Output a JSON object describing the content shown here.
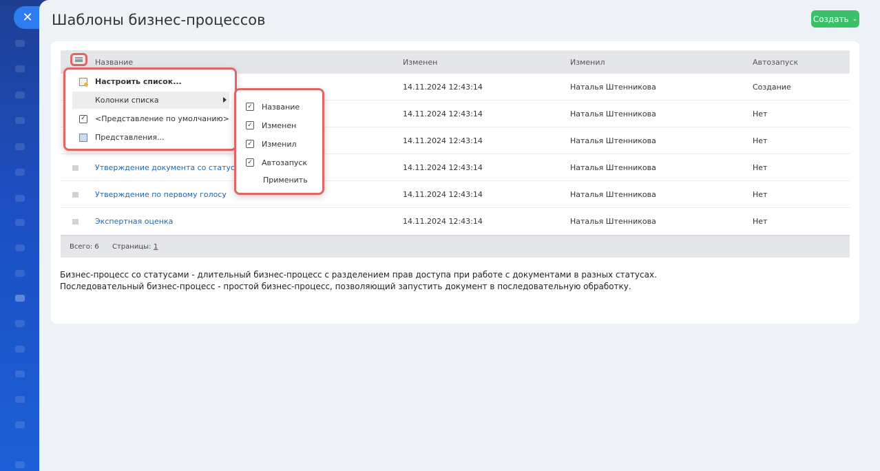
{
  "page": {
    "title": "Шаблоны бизнес-процессов",
    "create_label": "Создать",
    "close_icon": "close-icon"
  },
  "table": {
    "columns": [
      "Название",
      "Изменен",
      "Изменил",
      "Автозапуск"
    ],
    "rows": [
      {
        "name": "",
        "modified": "14.11.2024 12:43:14",
        "author": "Наталья Штенникова",
        "autorun": "Создание"
      },
      {
        "name": "",
        "modified": "14.11.2024 12:43:14",
        "author": "Наталья Штенникова",
        "autorun": "Нет"
      },
      {
        "name": "",
        "modified": "14.11.2024 12:43:14",
        "author": "Наталья Штенникова",
        "autorun": "Нет"
      },
      {
        "name": "Утверждение документа со статусами",
        "modified": "14.11.2024 12:43:14",
        "author": "Наталья Штенникова",
        "autorun": "Нет"
      },
      {
        "name": "Утверждение по первому голосу",
        "modified": "14.11.2024 12:43:14",
        "author": "Наталья Штенникова",
        "autorun": "Нет"
      },
      {
        "name": "Экспертная оценка",
        "modified": "14.11.2024 12:43:14",
        "author": "Наталья Штенникова",
        "autorun": "Нет"
      }
    ]
  },
  "footer": {
    "total": "Всего: 6",
    "pages_label": "Страницы:",
    "page_number": "1"
  },
  "description": {
    "line1": "Бизнес-процесс со статусами - длительный бизнес-процесс с разделением прав доступа при работе с документами в разных статусах.",
    "line2": "Последовательный бизнес-процесс - простой бизнес-процесс, позволяющий запустить документ в последовательную обработку."
  },
  "menu": {
    "configure": "Настроить список...",
    "columns": "Колонки списка",
    "default_view": "<Представление по умолчанию>",
    "views": "Представления..."
  },
  "columns_menu": {
    "items": [
      "Название",
      "Изменен",
      "Изменил",
      "Автозапуск"
    ],
    "checked": [
      true,
      true,
      true,
      true
    ],
    "apply": "Применить"
  },
  "colors": {
    "accent_create": "#3bc06a",
    "link": "#2067b0",
    "highlight_border": "#e06666"
  }
}
